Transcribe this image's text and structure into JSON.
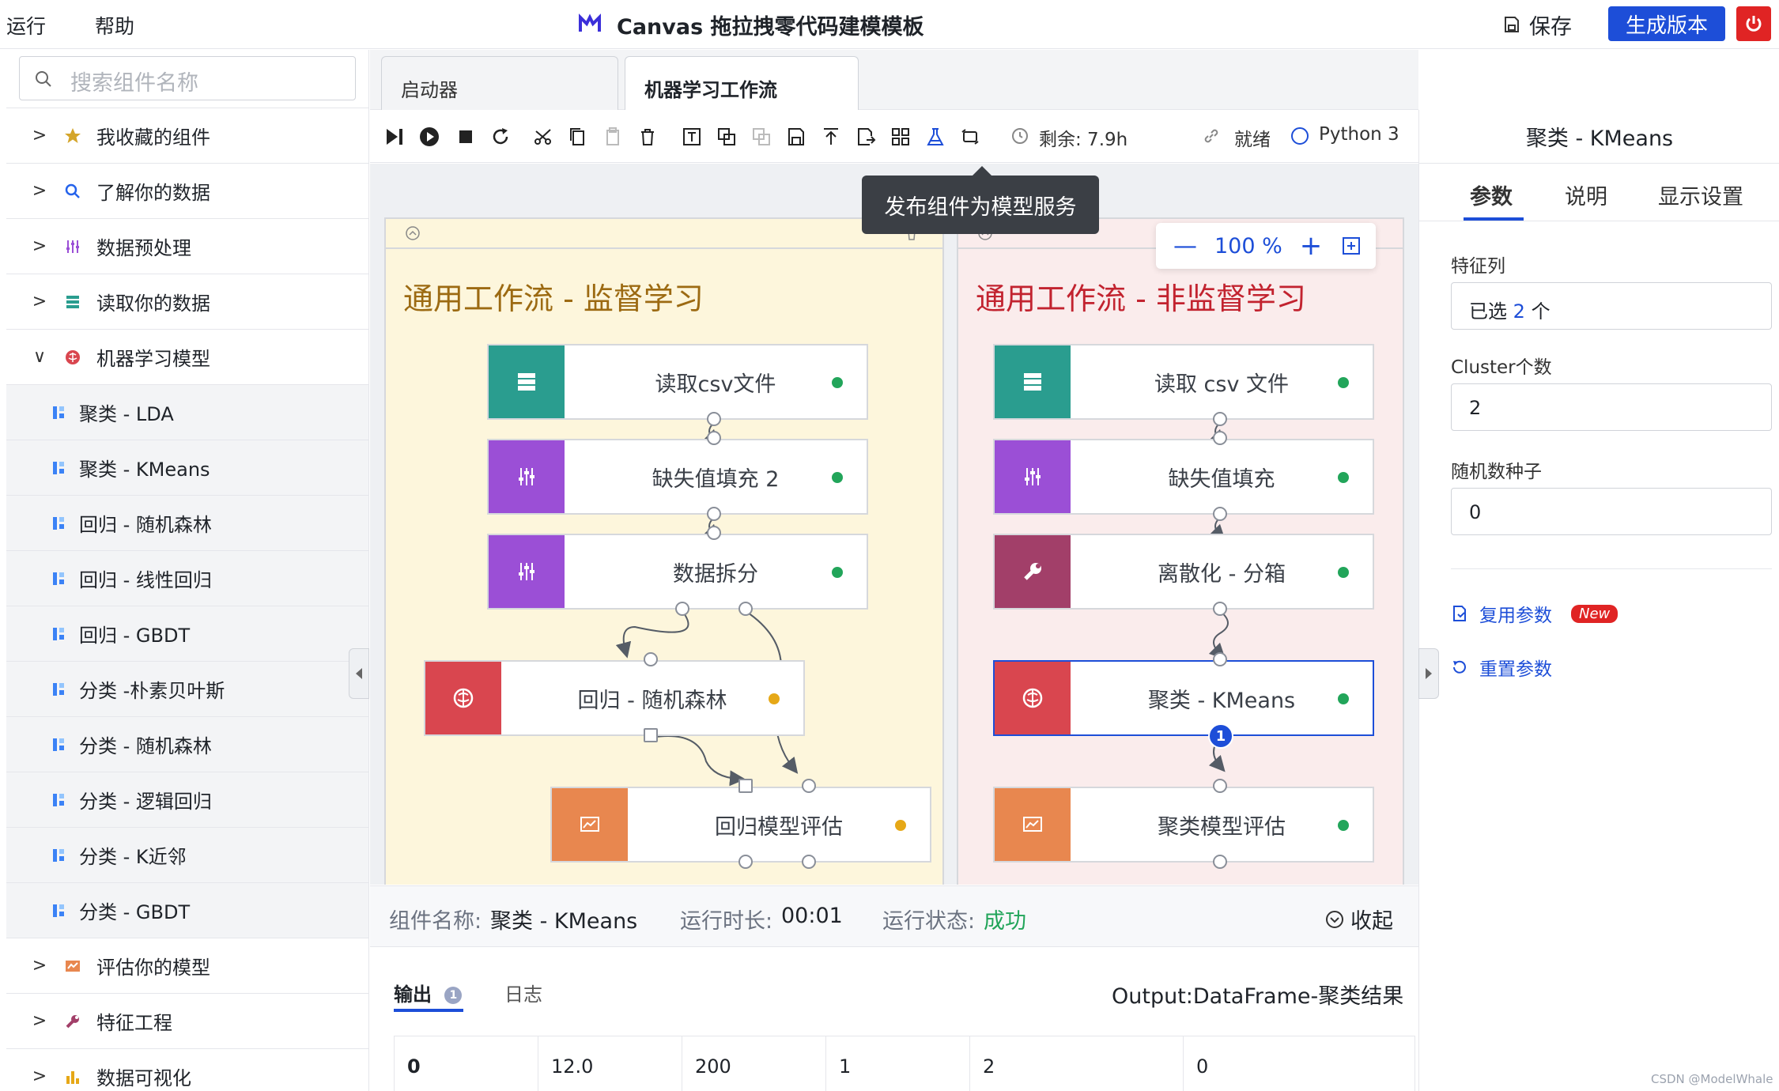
{
  "menu": {
    "run": "运行",
    "help": "帮助"
  },
  "app_title": "Canvas 拖拉拽零代码建模模板",
  "header": {
    "save": "保存",
    "generate": "生成版本"
  },
  "search": {
    "placeholder": "搜索组件名称"
  },
  "sidebar": {
    "items": [
      {
        "label": "我收藏的组件",
        "expanded": false,
        "icon": "star-icon"
      },
      {
        "label": "了解你的数据",
        "expanded": false,
        "icon": "magnify-data-icon"
      },
      {
        "label": "数据预处理",
        "expanded": false,
        "icon": "sliders-icon"
      },
      {
        "label": "读取你的数据",
        "expanded": false,
        "icon": "database-icon"
      },
      {
        "label": "机器学习模型",
        "expanded": true,
        "icon": "brain-icon"
      }
    ],
    "sub_items": [
      "聚类 - LDA",
      "聚类 - KMeans",
      "回归 - 随机森林",
      "回归 - 线性回归",
      "回归 - GBDT",
      "分类 -朴素贝叶斯",
      "分类 - 随机森林",
      "分类 - 逻辑回归",
      "分类 - K近邻",
      "分类 - GBDT"
    ],
    "bottom_items": [
      {
        "label": "评估你的模型",
        "icon": "chart-icon"
      },
      {
        "label": "特征工程",
        "icon": "wrench-icon"
      },
      {
        "label": "数据可视化",
        "icon": "bar-chart-icon"
      }
    ]
  },
  "tabs": {
    "launcher": "启动器",
    "workflow": "机器学习工作流"
  },
  "toolbar": {
    "remaining": "剩余: 7.9h",
    "status": "就绪",
    "kernel": "Python 3"
  },
  "tooltip": "发布组件为模型服务",
  "zoom": {
    "value": "100 %"
  },
  "groups": {
    "supervised": {
      "title": "通用工作流 - 监督学习",
      "nodes": [
        "读取csv文件",
        "缺失值填充 2",
        "数据拆分",
        "回归 - 随机森林",
        "回归模型评估"
      ]
    },
    "unsupervised": {
      "title": "通用工作流 - 非监督学习",
      "nodes": [
        "读取 csv 文件",
        "缺失值填充",
        "离散化 - 分箱",
        "聚类 - KMeans",
        "聚类模型评估"
      ]
    }
  },
  "node_badge": "1",
  "status_bar": {
    "name_label": "组件名称:",
    "name_value": "聚类 - KMeans",
    "time_label": "运行时长:",
    "time_value": "00:01",
    "state_label": "运行状态:",
    "state_value": "成功",
    "collapse": "收起"
  },
  "output": {
    "tab_output": "输出",
    "tab_output_badge": "1",
    "tab_log": "日志",
    "title": "Output:DataFrame-聚类结果",
    "row": [
      "0",
      "12.0",
      "200",
      "1",
      "2",
      "0"
    ]
  },
  "right_panel": {
    "title": "聚类 - KMeans",
    "tabs": [
      "参数",
      "说明",
      "显示设置"
    ],
    "feature_label": "特征列",
    "feature_value_prefix": "已选",
    "feature_value_count": "2",
    "feature_value_suffix": "个",
    "cluster_label": "Cluster个数",
    "cluster_value": "2",
    "seed_label": "随机数种子",
    "seed_value": "0",
    "reuse_params": "复用参数",
    "new_badge": "New",
    "reset_params": "重置参数"
  },
  "watermark": "CSDN @ModelWhale",
  "colors": {
    "accent": "#1d4ed8",
    "success": "#22a55a",
    "warning": "#e6a817",
    "node_teal": "#2a9d8f",
    "node_purple": "#9b4fd6",
    "node_red": "#d9464f",
    "node_orange": "#e8874f",
    "node_plum": "#a23f69"
  }
}
